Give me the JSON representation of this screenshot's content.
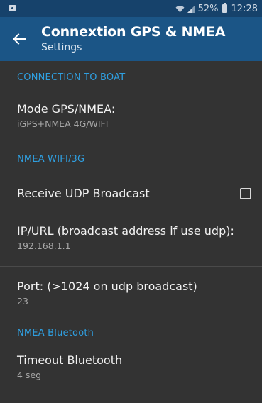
{
  "status_bar": {
    "battery": "52%",
    "time": "12:28"
  },
  "app_bar": {
    "title": "Connextion GPS & NMEA",
    "subtitle": "Settings"
  },
  "sections": {
    "connection": {
      "header": "CONNECTION TO BOAT",
      "mode": {
        "title": "Mode GPS/NMEA:",
        "summary": "iGPS+NMEA 4G/WIFI"
      }
    },
    "wifi": {
      "header": "NMEA WIFI/3G",
      "udp": {
        "title": "Receive UDP Broadcast",
        "checked": false
      },
      "ip": {
        "title": "IP/URL (broadcast address if use udp):",
        "summary": "192.168.1.1"
      },
      "port": {
        "title": "Port: (>1024 on udp broadcast)",
        "summary": "23"
      }
    },
    "bluetooth": {
      "header": "NMEA Bluetooth",
      "timeout": {
        "title": "Timeout Bluetooth",
        "summary": "4 seg"
      }
    }
  },
  "colors": {
    "status_bar": "#16426b",
    "app_bar": "#1b5586",
    "background": "#333333",
    "accent": "#2f9fe0"
  }
}
